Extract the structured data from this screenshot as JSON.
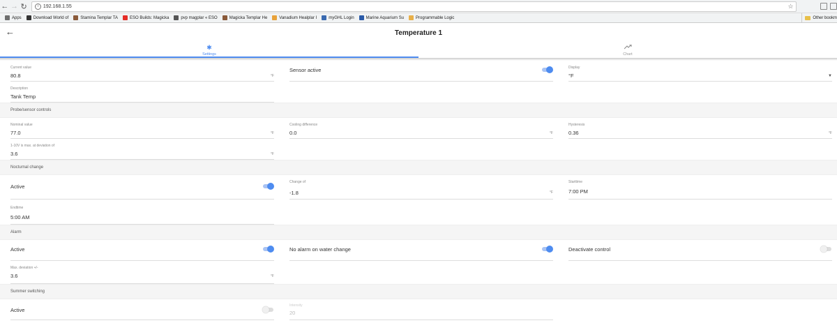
{
  "browser": {
    "url": "192.168.1.55",
    "bookmarks": [
      {
        "label": "Apps",
        "color": "#6e6e6e"
      },
      {
        "label": "Download World of",
        "color": "#333333"
      },
      {
        "label": "Stamina Templar TA",
        "color": "#8a5a3a"
      },
      {
        "label": "ESO Builds: Magicka",
        "color": "#e52d27"
      },
      {
        "label": "pvp magplar « ESO",
        "color": "#555555"
      },
      {
        "label": "Magicka Templar He",
        "color": "#8a5a3a"
      },
      {
        "label": "Vanadium Healplar I",
        "color": "#e8a23a"
      },
      {
        "label": "myGHL Login",
        "color": "#3a6ab0"
      },
      {
        "label": "Marine Aquarium Su",
        "color": "#2a5aa8"
      },
      {
        "label": "Programmable Logic",
        "color": "#e8b04a"
      }
    ],
    "other_bookmarks": "Other bookm"
  },
  "app": {
    "title": "Temperature 1",
    "tabs": [
      {
        "label": "Settings",
        "icon": "gear-icon"
      },
      {
        "label": "Chart",
        "icon": "trending-up-icon"
      }
    ]
  },
  "fields": {
    "current_value": {
      "label": "Current value",
      "value": "80.8",
      "unit": "°F"
    },
    "sensor_active": {
      "label": "Sensor active",
      "on": true
    },
    "display": {
      "label": "Display",
      "value": "°F"
    },
    "description": {
      "label": "Description",
      "value": "Tank Temp"
    },
    "nominal_value": {
      "label": "Nominal value",
      "value": "77.0",
      "unit": "°F"
    },
    "cooling_difference": {
      "label": "Cooling difference",
      "value": "0.0",
      "unit": "°F"
    },
    "hysteresis": {
      "label": "Hysteresis",
      "value": "0.36",
      "unit": "°F"
    },
    "max_deviation_10v": {
      "label": "1-10V is max. at deviation of",
      "value": "3.6",
      "unit": "°F"
    },
    "nocturnal_active": {
      "label": "Active",
      "on": true
    },
    "change_of": {
      "label": "Change of",
      "value": "-1.8",
      "unit": "°F"
    },
    "starttime": {
      "label": "Starttime",
      "value": "7:00 PM"
    },
    "endtime": {
      "label": "Endtime",
      "value": "5:00 AM"
    },
    "alarm_active": {
      "label": "Active",
      "on": true
    },
    "no_alarm_water_change": {
      "label": "No alarm on water change",
      "on": true
    },
    "deactivate_control": {
      "label": "Deactivate control",
      "on": false
    },
    "max_deviation": {
      "label": "Max. deviation +/-",
      "value": "3.6",
      "unit": "°F"
    },
    "summer_active": {
      "label": "Active",
      "on": false
    },
    "summer_intensity": {
      "label": "Intensity",
      "value": "20"
    }
  },
  "sections": {
    "probe": "Probe/sensor controls",
    "nocturnal": "Nocturnal change",
    "alarm": "Alarm",
    "summer": "Summer switching"
  }
}
